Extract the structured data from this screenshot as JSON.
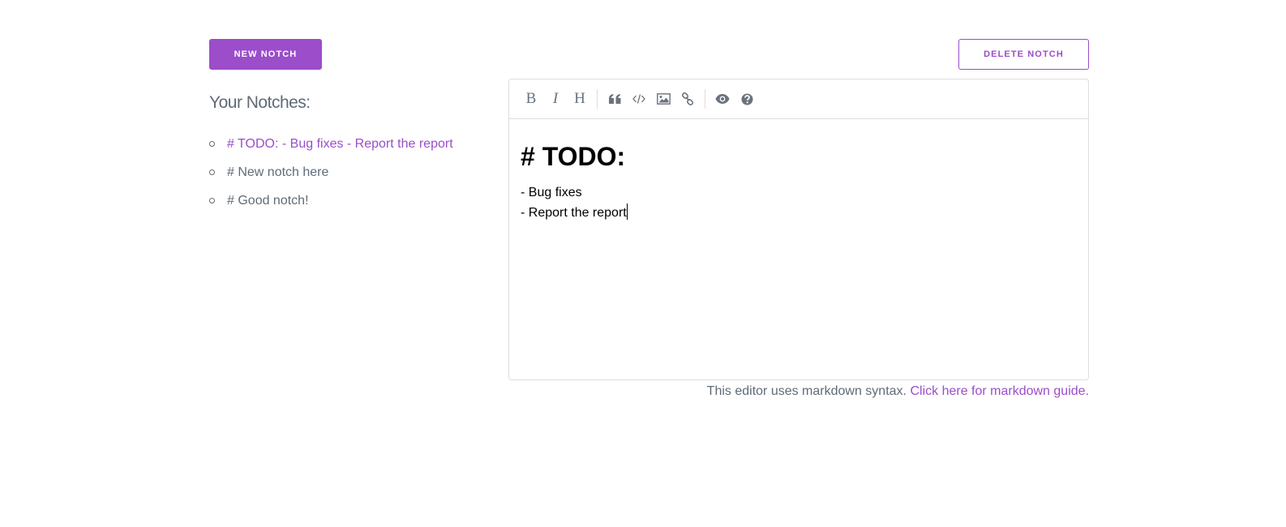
{
  "header": {
    "new_button_label": "New Notch",
    "delete_button_label": "Delete Notch"
  },
  "sidebar": {
    "title": "Your Notches:",
    "items": [
      {
        "label": "# TODO: - Bug fixes - Report the report",
        "active": true
      },
      {
        "label": "# New notch here",
        "active": false
      },
      {
        "label": "# Good notch!",
        "active": false
      }
    ]
  },
  "editor": {
    "toolbar": [
      {
        "name": "bold-icon",
        "glyph": "B"
      },
      {
        "name": "italic-icon",
        "glyph": "I"
      },
      {
        "name": "heading-icon",
        "glyph": "H"
      },
      {
        "name": "quote-icon"
      },
      {
        "name": "code-icon"
      },
      {
        "name": "image-icon"
      },
      {
        "name": "link-icon"
      },
      {
        "name": "preview-eye-icon"
      },
      {
        "name": "help-question-icon"
      }
    ],
    "content": {
      "heading": "# TODO:",
      "lines": [
        "- Bug fixes",
        "- Report the report"
      ]
    }
  },
  "footer": {
    "note_text": "This editor uses markdown syntax.",
    "link_text": "Click here for markdown guide."
  },
  "colors": {
    "accent": "#9b4dca",
    "text": "#5f6b77",
    "border": "#dddddd"
  }
}
